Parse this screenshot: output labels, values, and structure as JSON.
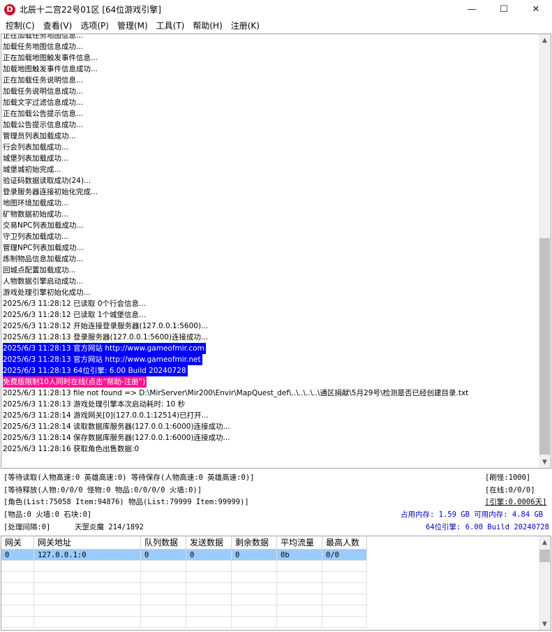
{
  "window": {
    "icon_letter": "D",
    "title": "北辰十二宫22号01区 [64位游戏引擎]",
    "minimize": "—",
    "maximize": "☐",
    "close": "✕"
  },
  "menu": [
    "控制(C)",
    "查看(V)",
    "选项(P)",
    "管理(M)",
    "工具(T)",
    "帮助(H)",
    "注册(K)"
  ],
  "log_lines": [
    {
      "text": "正在加载任务地图信息...",
      "style": ""
    },
    {
      "text": "加载任务地图信息成功...",
      "style": ""
    },
    {
      "text": "正在加载地图触发事件信息...",
      "style": ""
    },
    {
      "text": "加载地图触发事件信息成功...",
      "style": ""
    },
    {
      "text": "正在加载任务说明信息...",
      "style": ""
    },
    {
      "text": "加载任务说明信息成功...",
      "style": ""
    },
    {
      "text": "加载文字过滤信息成功...",
      "style": ""
    },
    {
      "text": "正在加载公告提示信息...",
      "style": ""
    },
    {
      "text": "加载公告提示信息成功...",
      "style": ""
    },
    {
      "text": "管理员列表加载成功...",
      "style": ""
    },
    {
      "text": "行会列表加载成功...",
      "style": ""
    },
    {
      "text": "城堡列表加载成功...",
      "style": ""
    },
    {
      "text": "城堡城初始完成...",
      "style": ""
    },
    {
      "text": "验证码数据读取成功(24)...",
      "style": ""
    },
    {
      "text": "登录服务器连接初始化完成...",
      "style": ""
    },
    {
      "text": "地图环境加载成功...",
      "style": ""
    },
    {
      "text": "矿物数据初始成功...",
      "style": ""
    },
    {
      "text": "交易NPC列表加载成功...",
      "style": ""
    },
    {
      "text": "守卫列表加载成功...",
      "style": ""
    },
    {
      "text": "管理NPC列表加载成功...",
      "style": ""
    },
    {
      "text": "炼制物品信息加载成功...",
      "style": ""
    },
    {
      "text": "回城点配置加载成功...",
      "style": ""
    },
    {
      "text": "人物数据引擎启动成功...",
      "style": ""
    },
    {
      "text": "游戏处理引擎初始化成功...",
      "style": ""
    },
    {
      "text": "2025/6/3 11:28:12 已读取 0个行会信息...",
      "style": ""
    },
    {
      "text": "2025/6/3 11:28:12 已读取 1个城堡信息...",
      "style": ""
    },
    {
      "text": "2025/6/3 11:28:12 开始连接登录服务器(127.0.0.1:5600)...",
      "style": ""
    },
    {
      "text": "2025/6/3 11:28:13 登录服务器(127.0.0.1:5600)连接成功...",
      "style": ""
    },
    {
      "text": "2025/6/3 11:28:13 官方网站 http://www.gameofmir.com",
      "style": "blue"
    },
    {
      "text": "2025/6/3 11:28:13 官方网站 http://www.gameofmir.net",
      "style": "blue"
    },
    {
      "text": "2025/6/3 11:28:13 64位引擎: 6.00 Build 20240728",
      "style": "blue"
    },
    {
      "text": "免费版限制10人同时在线(点击“帮助-注册”)",
      "style": "pink"
    },
    {
      "text": "2025/6/3 11:28:13 file not found => D:\\MirServer\\Mir200\\Envir\\MapQuest_def\\..\\..\\..\\..\\通区捐献\\5月29号\\检测是否已经创建目录.txt",
      "style": ""
    },
    {
      "text": "2025/6/3 11:28:13 游戏处理引擎本次启动耗时: 10 秒",
      "style": ""
    },
    {
      "text": "2025/6/3 11:28:14 游戏网关[0](127.0.0.1:12514)已打开...",
      "style": ""
    },
    {
      "text": "2025/6/3 11:28:14 读取数据库服务器(127.0.0.1:6000)连接成功...",
      "style": ""
    },
    {
      "text": "2025/6/3 11:28:14 保存数据库服务器(127.0.0.1:6000)连接成功...",
      "style": ""
    },
    {
      "text": "2025/6/3 11:28:16 获取角色出售数据:0",
      "style": ""
    }
  ],
  "status": {
    "row1_left": "[等待读取(人物高速:0 英雄高速:0) 等待保存(人物高速:0 英雄高速:0)]",
    "row1_right": "[刷怪:1000]",
    "row2_left": "[等待释放(人物:0/0/0 怪物:0 物品:0/0/0/0 火墙:0)]",
    "row2_right": "[在线:0/0/0]",
    "row3_left": "[角色(List:75058 Item:94876) 物品(List:79999 Item:99999)]",
    "row3_right": "[引擎:0.0006天]",
    "row4_left": "[物品:0 火墙:0 石块:0]",
    "row4_right": "占用内存: 1.59 GB 可用内存: 4.84 GB",
    "row5_left": "[处理间隔:0]",
    "row5_mid": "天罡炎魔 214/1892",
    "row5_right": "64位引擎: 6.00 Build 20240728"
  },
  "gateway_table": {
    "headers": [
      "网关",
      "网关地址",
      "队列数据",
      "发送数据",
      "剩余数据",
      "平均流量",
      "最高人数"
    ],
    "rows": [
      [
        "0",
        "127.0.0.1:0",
        "0",
        "0",
        "0",
        "0b",
        "0/0"
      ]
    ]
  }
}
